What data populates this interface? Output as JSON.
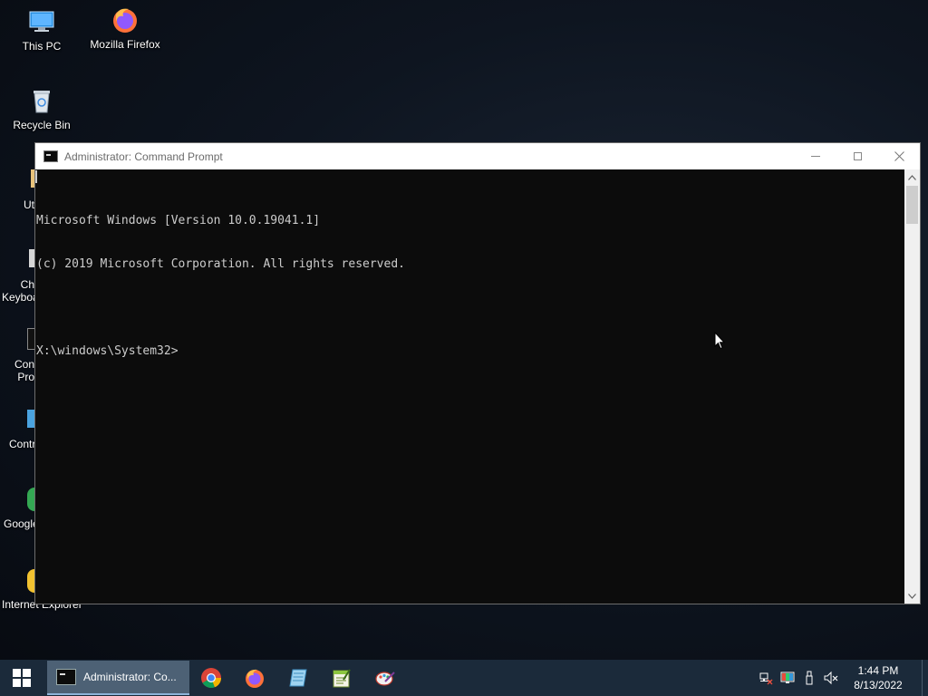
{
  "desktop": {
    "icons": [
      {
        "label": "This PC",
        "icon": "computer-icon"
      },
      {
        "label": "Mozilla Firefox",
        "icon": "firefox-icon"
      },
      {
        "label": "Recycle Bin",
        "icon": "recycle-bin-icon"
      }
    ],
    "partial_icons": [
      {
        "label": "Ut",
        "icon": "utility-icon"
      },
      {
        "label": "Ch\nKeyboa",
        "icon": "keyboard-icon"
      },
      {
        "label": "Con\nPro",
        "icon": "command-prompt-icon"
      },
      {
        "label": "Contr",
        "icon": "control-panel-icon"
      },
      {
        "label": "Google",
        "icon": "chrome-icon"
      },
      {
        "label": "Internet Explorer",
        "icon": "ie-icon"
      }
    ]
  },
  "cmd_window": {
    "title": "Administrator: Command Prompt",
    "lines": [
      "Microsoft Windows [Version 10.0.19041.1]",
      "(c) 2019 Microsoft Corporation. All rights reserved.",
      "",
      "X:\\windows\\System32>"
    ]
  },
  "taskbar": {
    "active_task_label": "Administrator: Co...",
    "pinned": [
      "chrome-icon",
      "firefox-icon",
      "notepad-icon",
      "notepad-plus-icon",
      "paint-icon"
    ],
    "clock": {
      "time": "1:44 PM",
      "date": "8/13/2022"
    }
  }
}
